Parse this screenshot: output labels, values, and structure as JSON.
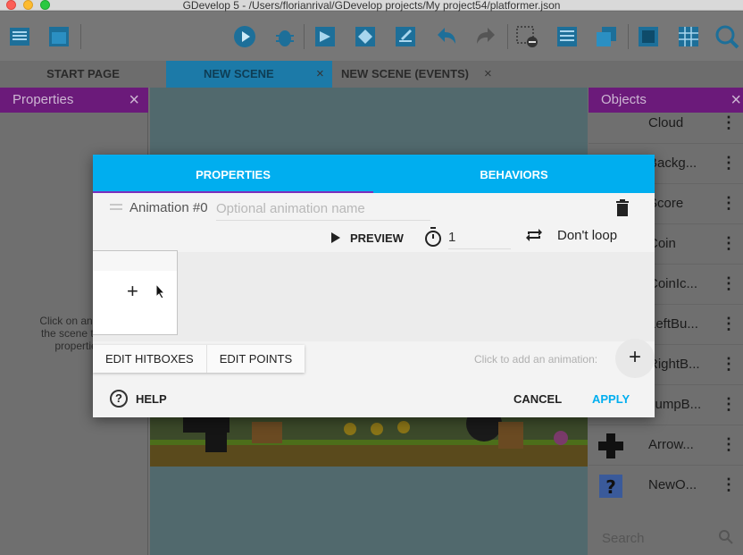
{
  "window": {
    "title": "GDevelop 5 - /Users/florianrival/GDevelop projects/My project54/platformer.json"
  },
  "tabs": [
    {
      "label": "START PAGE"
    },
    {
      "label": "NEW SCENE",
      "close": "×"
    },
    {
      "label": "NEW SCENE (EVENTS)",
      "close": "×"
    }
  ],
  "properties_panel": {
    "title": "Properties",
    "close": "×",
    "hint_lines": [
      "Click on an inst",
      "the scene to di",
      "propertie"
    ]
  },
  "objects_panel": {
    "title": "Objects",
    "close": "×",
    "menu_glyph": "⋮",
    "items": [
      {
        "label": "Cloud"
      },
      {
        "label": "Backg..."
      },
      {
        "label": "Score"
      },
      {
        "label": "Coin"
      },
      {
        "label": "CoinIc..."
      },
      {
        "label": "LeftBu..."
      },
      {
        "label": "RightB..."
      },
      {
        "label": "JumpB..."
      },
      {
        "label": "Arrow..."
      },
      {
        "label": "NewO..."
      }
    ],
    "search_placeholder": "Search"
  },
  "dialog": {
    "tabs": {
      "properties": "PROPERTIES",
      "behaviors": "BEHAVIORS"
    },
    "animation": {
      "label": "Animation #0",
      "name_placeholder": "Optional animation name",
      "name_value": "",
      "preview_label": "PREVIEW",
      "time_between_frames": "1",
      "loop_label": "Don't loop"
    },
    "frame_add_glyph": "+",
    "edit_hitboxes_label": "EDIT HITBOXES",
    "edit_points_label": "EDIT POINTS",
    "add_animation_hint": "Click to add an animation:",
    "add_animation_glyph": "+",
    "help_label": "HELP",
    "help_glyph": "?",
    "cancel_label": "CANCEL",
    "apply_label": "APPLY"
  },
  "colors": {
    "accent": "#00aeef",
    "panel_header": "#6b1a7a",
    "tab_active": "#1c7aa8",
    "tab_underline": "#7b2fbe"
  }
}
